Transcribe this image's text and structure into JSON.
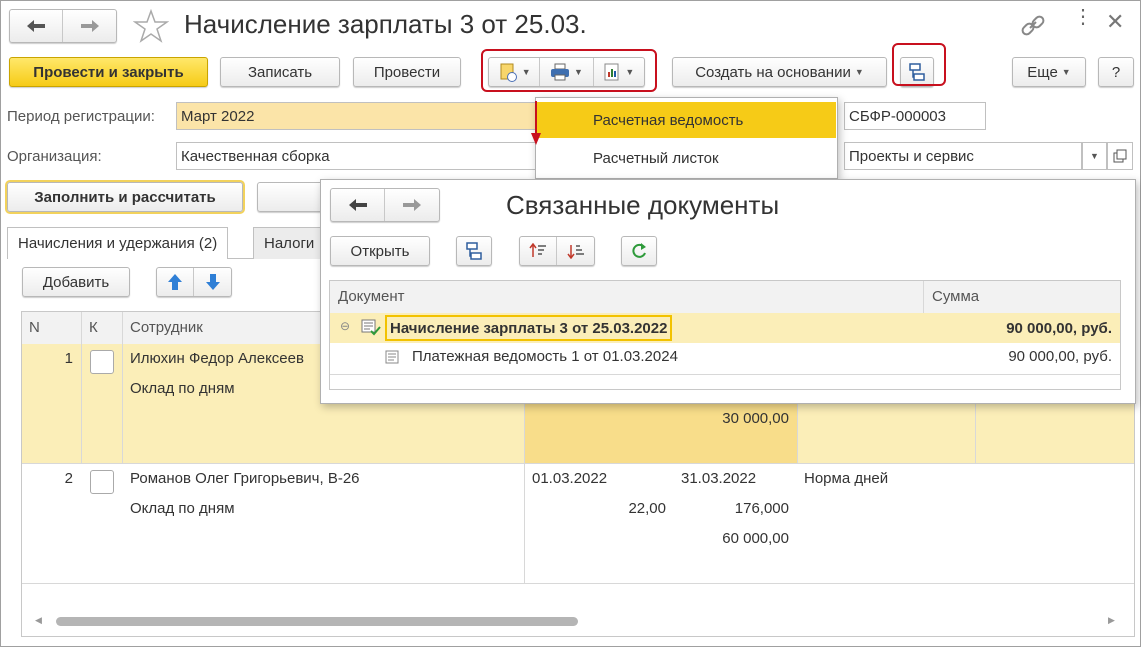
{
  "title": "Начисление зарплаты 3 от 25.03.",
  "toolbar": {
    "post_close": "Провести и закрыть",
    "save": "Записать",
    "post": "Провести",
    "create_based": "Создать на основании",
    "more": "Еще",
    "help": "?"
  },
  "form": {
    "period_label": "Период регистрации:",
    "period_value": "Март 2022",
    "org_label": "Организация:",
    "org_value": "Качественная сборка",
    "number_value": "СБФР-000003",
    "division_value": "Проекты и сервис",
    "fill_calc": "Заполнить и рассчитать"
  },
  "print_menu": {
    "items": [
      "Расчетная ведомость",
      "Расчетный листок"
    ]
  },
  "tabs": [
    "Начисления и удержания (2)",
    "Налоги"
  ],
  "table_toolbar": {
    "add": "Добавить"
  },
  "table": {
    "headers": [
      "N",
      "К",
      "Сотрудник"
    ],
    "rows": [
      {
        "n": "1",
        "employee": "Илюхин Федор Алексеев",
        "type": "Оклад по дням",
        "sum": "30 000,00"
      },
      {
        "n": "2",
        "employee": "Романов Олег Григорьевич, В-26",
        "type": "Оклад по дням",
        "from": "01.03.2022",
        "to": "31.03.2022",
        "norm": "Норма дней",
        "days": "22,00",
        "rate": "176,000",
        "sum": "60 000,00"
      }
    ]
  },
  "related": {
    "title": "Связанные документы",
    "open": "Открыть",
    "col_doc": "Документ",
    "col_sum": "Сумма",
    "rows": [
      {
        "doc": "Начисление зарплаты 3 от 25.03.2022",
        "sum": "90 000,00, руб."
      },
      {
        "doc": "Платежная ведомость 1 от 01.03.2024",
        "sum": "90 000,00, руб."
      }
    ]
  },
  "colors": {
    "accent_yellow": "#f6cb17",
    "highlight_red": "#c8101e",
    "row_selected": "#fbeeb8"
  }
}
